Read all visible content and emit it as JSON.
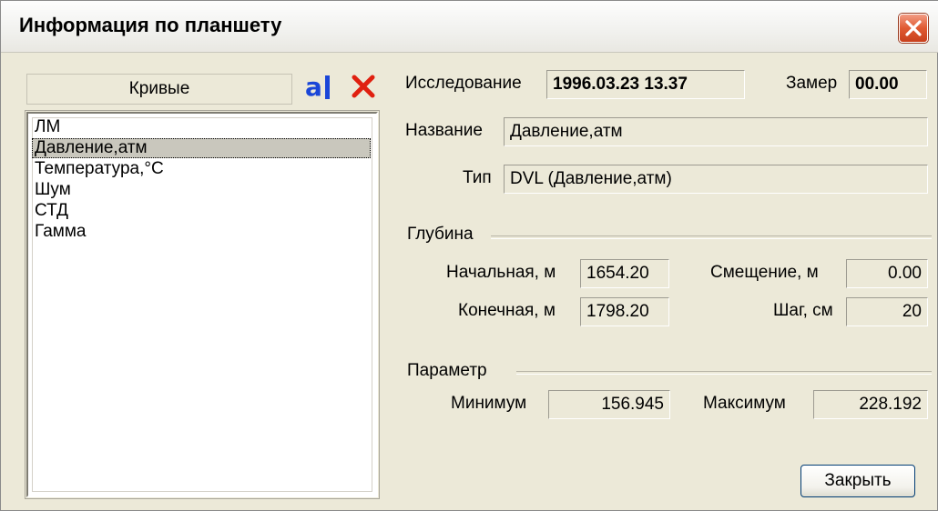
{
  "window": {
    "title": "Информация по планшету"
  },
  "curves": {
    "header": "Кривые",
    "rename_glyph": "a",
    "items": [
      "ЛМ",
      "Давление,атм",
      "Температура,°С",
      "Шум",
      "СТД",
      "Гамма"
    ],
    "selected_index": 1
  },
  "study": {
    "label": "Исследование",
    "value": "1996.03.23 13.37",
    "measure_label": "Замер",
    "measure_value": "00.00"
  },
  "name": {
    "label": "Название",
    "value": "Давление,атм"
  },
  "type": {
    "label": "Тип",
    "value": "DVL (Давление,атм)"
  },
  "depth": {
    "group_label": "Глубина",
    "start_label": "Начальная, м",
    "start_value": "1654.20",
    "end_label": "Конечная, м",
    "end_value": "1798.20",
    "offset_label": "Смещение, м",
    "offset_value": "0.00",
    "step_label": "Шаг, см",
    "step_value": "20"
  },
  "parameter": {
    "group_label": "Параметр",
    "min_label": "Минимум",
    "min_value": "156.945",
    "max_label": "Максимум",
    "max_value": "228.192"
  },
  "buttons": {
    "close": "Закрыть"
  }
}
